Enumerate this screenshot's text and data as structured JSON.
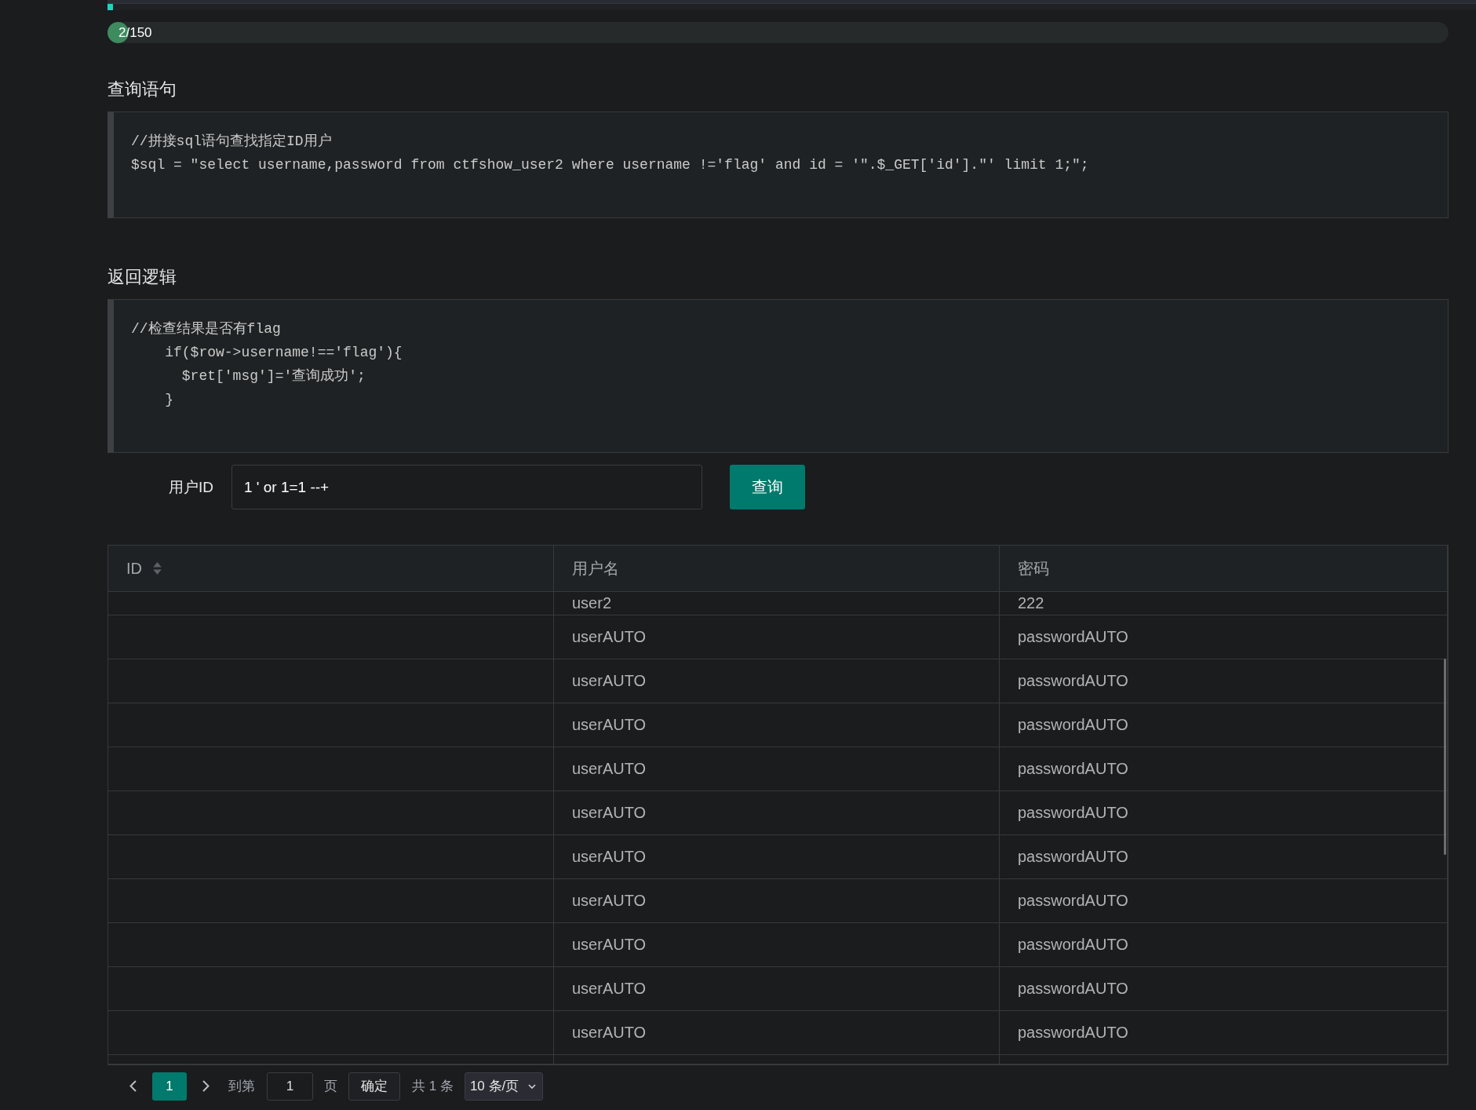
{
  "top_bar": {
    "level": 0.004
  },
  "progress": {
    "label": "2/150",
    "level": 0.013
  },
  "sections": [
    {
      "heading": "查询语句",
      "code_lines": [
        "//拼接sql语句查找指定ID用户",
        "$sql = \"select username,password from ctfshow_user2 where username !='flag' and id = '\".$_GET['id'].\"' limit 1;\";"
      ]
    },
    {
      "heading": "返回逻辑",
      "code_lines": [
        "//检查结果是否有flag",
        "    if($row->username!=='flag'){",
        "      $ret['msg']='查询成功';",
        "    }"
      ]
    }
  ],
  "query_form": {
    "label": "用户ID",
    "value": "1 ' or 1=1 --+",
    "button": "查询"
  },
  "table": {
    "columns": [
      {
        "label": "ID",
        "sortable": true
      },
      {
        "label": "用户名",
        "sortable": false
      },
      {
        "label": "密码",
        "sortable": false
      }
    ],
    "rows": [
      {
        "username": "user2",
        "password": "222"
      },
      {
        "username": "userAUTO",
        "password": "passwordAUTO"
      },
      {
        "username": "userAUTO",
        "password": "passwordAUTO"
      },
      {
        "username": "userAUTO",
        "password": "passwordAUTO"
      },
      {
        "username": "userAUTO",
        "password": "passwordAUTO"
      },
      {
        "username": "userAUTO",
        "password": "passwordAUTO"
      },
      {
        "username": "userAUTO",
        "password": "passwordAUTO"
      },
      {
        "username": "userAUTO",
        "password": "passwordAUTO"
      },
      {
        "username": "userAUTO",
        "password": "passwordAUTO"
      },
      {
        "username": "userAUTO",
        "password": "passwordAUTO"
      },
      {
        "username": "userAUTO",
        "password": "passwordAUTO"
      }
    ]
  },
  "pagination": {
    "pages": [
      {
        "label": "1",
        "selected": true
      }
    ],
    "goto_label": "到第",
    "goto_value": "1",
    "goto_suffix": "页",
    "confirm": "确定",
    "total": "共 1 条",
    "page_size": "10 条/页"
  }
}
